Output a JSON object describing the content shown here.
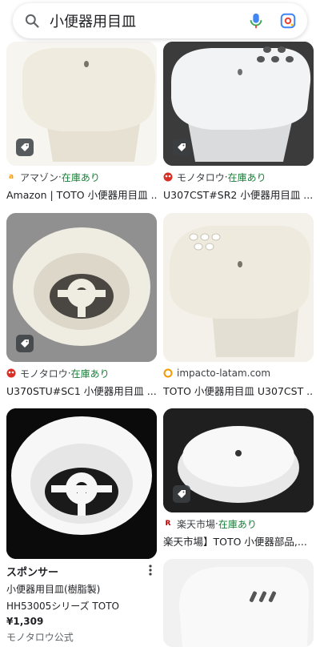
{
  "search": {
    "query": "小便器用目皿"
  },
  "colors": {
    "in_stock": "#188038",
    "amazon": "#ff9900",
    "monotaro": "#d93025",
    "rakuten": "#bf0000",
    "impacto": "#f29900"
  },
  "results": [
    {
      "source": "アマゾン",
      "stock": "在庫あり",
      "title": "Amazon | TOTO 小便器用目皿 ...",
      "favicon": "amazon-icon"
    },
    {
      "source": "モノタロウ",
      "stock": "在庫あり",
      "title": "U307CST#SR2 小便器用目皿 ...",
      "favicon": "monotaro-icon"
    },
    {
      "source": "モノタロウ",
      "stock": "在庫あり",
      "title": "U370STU#SC1 小便器用目皿 ...",
      "favicon": "monotaro-icon"
    },
    {
      "source": "impacto-latam.com",
      "stock": "",
      "title": "TOTO 小便器用目皿 U307CST ...",
      "favicon": "impacto-icon"
    },
    {
      "source": "楽天市場",
      "stock": "在庫あり",
      "title": "楽天市場】TOTO 小便器部品,...",
      "favicon": "rakuten-icon"
    }
  ],
  "sponsored": {
    "label": "スポンサー",
    "line1": "小便器用目皿(樹脂製)",
    "line2": "HH53005シリーズ TOTO",
    "price": "¥1,309",
    "merchant": "モノタロウ公式"
  },
  "separator": " · "
}
